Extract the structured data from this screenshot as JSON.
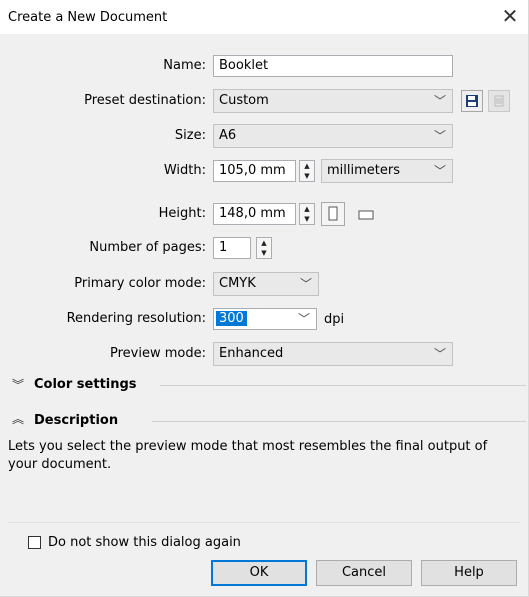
{
  "dialog": {
    "title": "Create a New Document",
    "close_glyph": "✕"
  },
  "form": {
    "name": {
      "label": "Name:",
      "value": "Booklet"
    },
    "preset": {
      "label": "Preset destination:",
      "value": "Custom"
    },
    "size": {
      "label": "Size:",
      "value": "A6"
    },
    "width": {
      "label": "Width:",
      "value": "105,0 mm",
      "units": "millimeters"
    },
    "height": {
      "label": "Height:",
      "value": "148,0 mm"
    },
    "pages": {
      "label": "Number of pages:",
      "value": "1"
    },
    "color_mode": {
      "label": "Primary color mode:",
      "value": "CMYK"
    },
    "resolution": {
      "label": "Rendering resolution:",
      "value": "300",
      "unit": "dpi"
    },
    "preview": {
      "label": "Preview mode:",
      "value": "Enhanced"
    }
  },
  "sections": {
    "color_settings": {
      "label": "Color settings",
      "expanded": false
    },
    "description": {
      "label": "Description",
      "expanded": true,
      "text_line1": "Lets you select the preview mode that most resembles the final output of",
      "text_line2": "your document."
    }
  },
  "footer": {
    "dont_show_label": "Do not show this dialog again",
    "dont_show_checked": false,
    "ok_label": "OK",
    "cancel_label": "Cancel",
    "help_label": "Help"
  },
  "icons": {
    "save_preset": "floppy-disk-icon",
    "delete_preset": "delete-icon",
    "portrait": "portrait-orientation-icon",
    "landscape": "landscape-orientation-icon",
    "chevron": "chevron-down-icon",
    "expand": "expand-chevrons-icon",
    "collapse": "collapse-chevrons-icon"
  },
  "colors": {
    "selection": "#0078d7",
    "save_icon": "#1e3d74"
  }
}
